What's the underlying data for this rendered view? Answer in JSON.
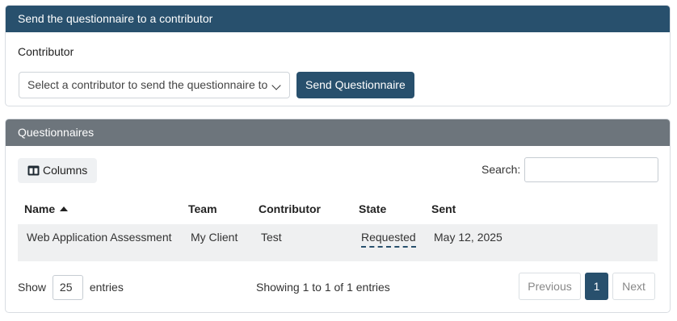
{
  "send_card": {
    "header": "Send the questionnaire to a contributor",
    "contributor_label": "Contributor",
    "select_placeholder": "Select a contributor to send the questionnaire to",
    "send_button": "Send Questionnaire"
  },
  "questionnaires_card": {
    "header": "Questionnaires",
    "columns_button": "Columns",
    "search_label": "Search:",
    "search_value": "",
    "columns": [
      "Name",
      "Team",
      "Contributor",
      "State",
      "Sent"
    ],
    "sort_column": "Name",
    "sort_direction": "ascending",
    "rows": [
      {
        "name": "Web Application Assessment",
        "team": "My Client",
        "contributor": "Test",
        "state": "Requested",
        "sent": "May 12, 2025"
      }
    ],
    "show_label": "Show",
    "page_length": "25",
    "entries_label": "entries",
    "info": "Showing 1 to 1 of 1 entries",
    "pagination": {
      "previous": "Previous",
      "current": "1",
      "next": "Next"
    }
  },
  "colors": {
    "primary": "#28506d",
    "header_gray": "#6d757c",
    "row_bg": "#eff0f1"
  },
  "icons": [
    "chevron-down-icon",
    "columns-icon",
    "sort-up-icon"
  ]
}
